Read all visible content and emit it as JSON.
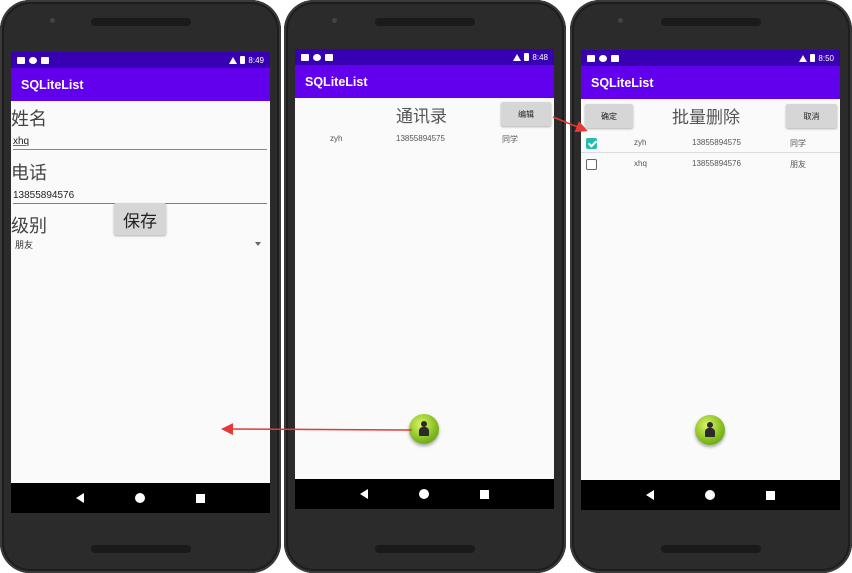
{
  "app_title": "SQLiteList",
  "screen1": {
    "time": "8:49",
    "name_label": "姓名",
    "name_value": "xhq",
    "phone_label": "电话",
    "phone_value": "13855894576",
    "level_label": "级别",
    "level_value": "朋友",
    "save_label": "保存"
  },
  "screen2": {
    "time": "8:48",
    "title": "通讯录",
    "edit_label": "编辑",
    "rows": [
      {
        "name": "zyh",
        "phone": "13855894575",
        "group": "同学"
      }
    ]
  },
  "screen3": {
    "time": "8:50",
    "confirm_label": "确定",
    "title": "批量删除",
    "cancel_label": "取消",
    "rows": [
      {
        "checked": true,
        "name": "zyh",
        "phone": "13855894575",
        "group": "同学"
      },
      {
        "checked": false,
        "name": "xhq",
        "phone": "13855894576",
        "group": "朋友"
      }
    ]
  },
  "colors": {
    "status_bar": "#3700b3",
    "app_bar": "#6200ee",
    "accent": "#26a69a",
    "arrow": "#e53935"
  },
  "icons": [
    "back-icon",
    "home-icon",
    "recents-icon",
    "add-contact-fab-icon",
    "checkbox-icon",
    "dropdown-caret-icon"
  ]
}
